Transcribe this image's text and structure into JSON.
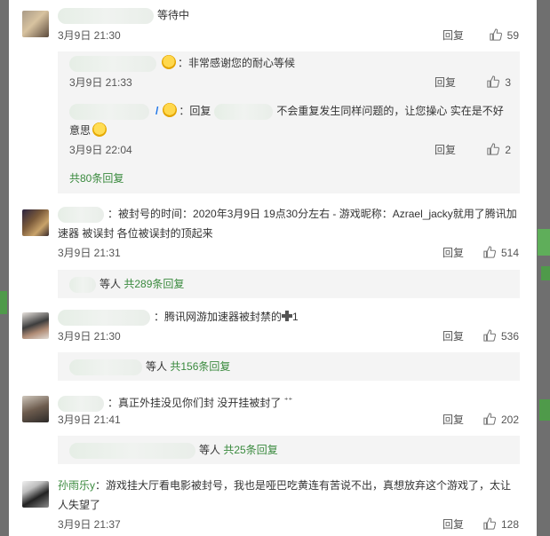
{
  "comments": [
    {
      "text": "等待中",
      "time": "3月9日 21:30",
      "reply_label": "回复",
      "likes": "59",
      "replies": [
        {
          "text": "非常感谢您的耐心等候",
          "time": "3月9日 21:33",
          "reply_label": "回复",
          "likes": "3"
        },
        {
          "prefix": "回复",
          "text": "不会重复发生同样问题的，让您操心 实在是不好",
          "text2": "意思",
          "time": "3月9日 22:04",
          "reply_label": "回复",
          "likes": "2"
        }
      ],
      "more": "共80条回复"
    },
    {
      "text": "被封号的时间：2020年3月9日 19点30分左右 - 游戏昵称：Azrael_jacky就用了腾讯加",
      "text2": "速器  被误封 各位被误封的顶起来",
      "time": "3月9日 21:31",
      "reply_label": "回复",
      "likes": "514",
      "summary_prefix": "等人",
      "more": "共289条回复"
    },
    {
      "text": "腾讯网游加速器被封禁的",
      "text_suffix": "1",
      "time": "3月9日 21:30",
      "reply_label": "回复",
      "likes": "536",
      "summary_prefix": "等人",
      "more": "共156条回复"
    },
    {
      "text": "真正外挂没见你们封 没开挂被封了",
      "time": "3月9日 21:41",
      "reply_label": "回复",
      "likes": "202",
      "summary_prefix": "等人",
      "more": "共25条回复"
    },
    {
      "name": "孙雨乐y",
      "text": "：游戏挂大厅看电影被封号，我也是哑巴吃黄连有苦说不出，真想放弃这个游戏了，太让",
      "text2": "人失望了",
      "time": "3月9日 21:37",
      "reply_label": "回复",
      "likes": "128"
    }
  ],
  "colors": {
    "link_green": "#3a8a3e",
    "sub_bg": "#f4f4f4",
    "backdrop": "#6f6f6f"
  },
  "icons": [
    "thumbs-up-icon",
    "plus-icon",
    "smile-emoji-icon",
    "crying-emoji-icon"
  ]
}
